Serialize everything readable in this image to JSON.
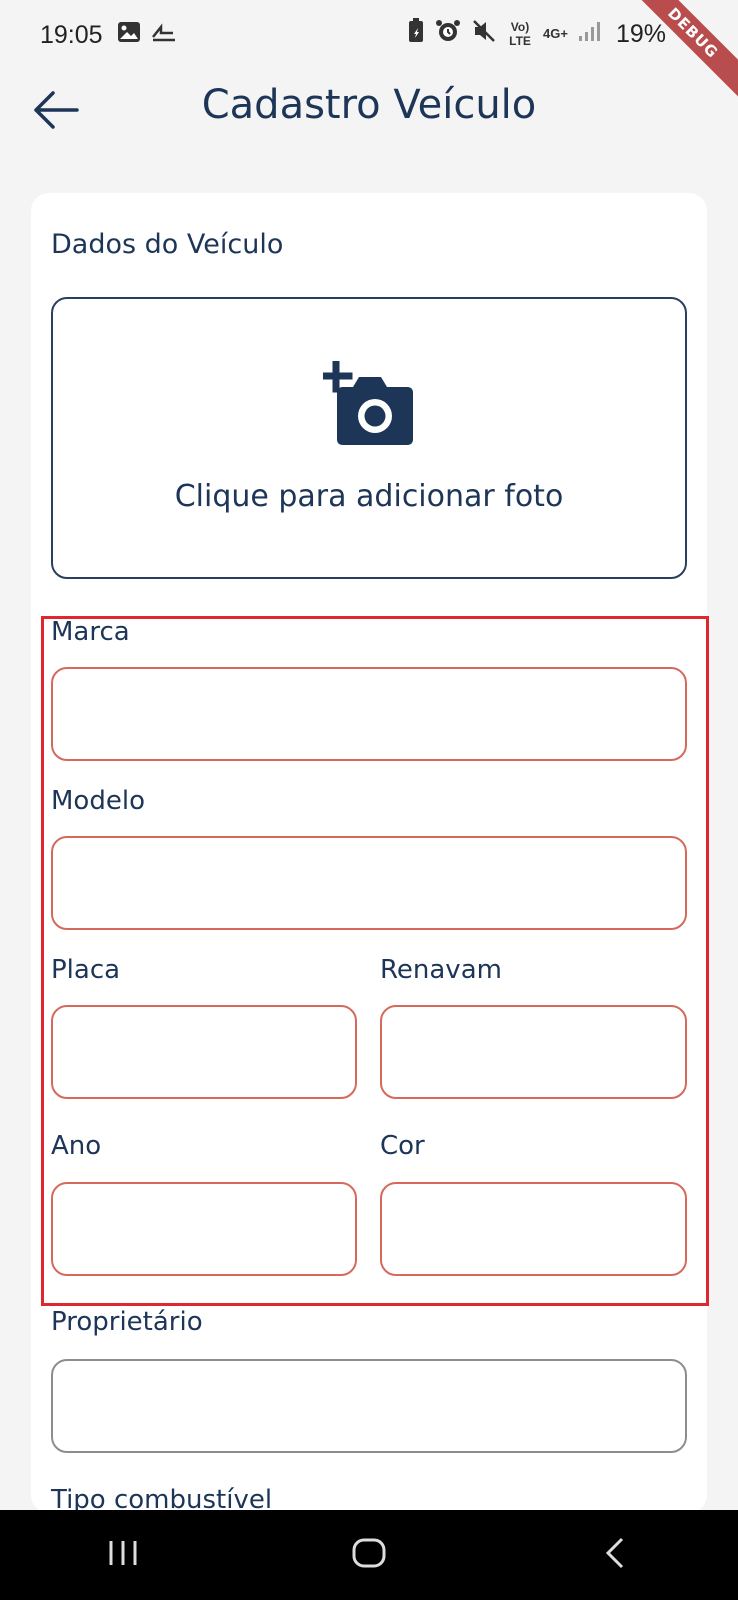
{
  "status_bar": {
    "time": "19:05",
    "battery_percent": "19%",
    "icons_left": [
      "image-icon",
      "cast-icon"
    ],
    "icons_right": [
      "battery-saver-icon",
      "alarm-icon",
      "mute-icon",
      "volte-icon",
      "4g-icon",
      "signal-icon"
    ],
    "volte_label": "Vo) LTE",
    "network_label": "4G+"
  },
  "debug_banner": "DEBUG",
  "app_bar": {
    "title": "Cadastro Veículo",
    "back_icon": "arrow-left-icon"
  },
  "form": {
    "section_title": "Dados do Veículo",
    "photo": {
      "icon": "add-photo-icon",
      "label": "Clique para adicionar foto"
    },
    "fields": {
      "marca": {
        "label": "Marca",
        "value": ""
      },
      "modelo": {
        "label": "Modelo",
        "value": ""
      },
      "placa": {
        "label": "Placa",
        "value": ""
      },
      "renavam": {
        "label": "Renavam",
        "value": ""
      },
      "ano": {
        "label": "Ano",
        "value": ""
      },
      "cor": {
        "label": "Cor",
        "value": ""
      },
      "proprietario": {
        "label": "Proprietário",
        "value": ""
      },
      "tipo_combustivel": {
        "label": "Tipo combustível"
      }
    },
    "error_border_color": "#d56a5c",
    "highlight_color": "#e0262f"
  },
  "nav_bar": {
    "buttons": [
      "recent-apps-icon",
      "home-icon",
      "back-icon"
    ]
  },
  "colors": {
    "primary": "#1d3557",
    "background": "#f4f4f5",
    "card": "#ffffff"
  }
}
